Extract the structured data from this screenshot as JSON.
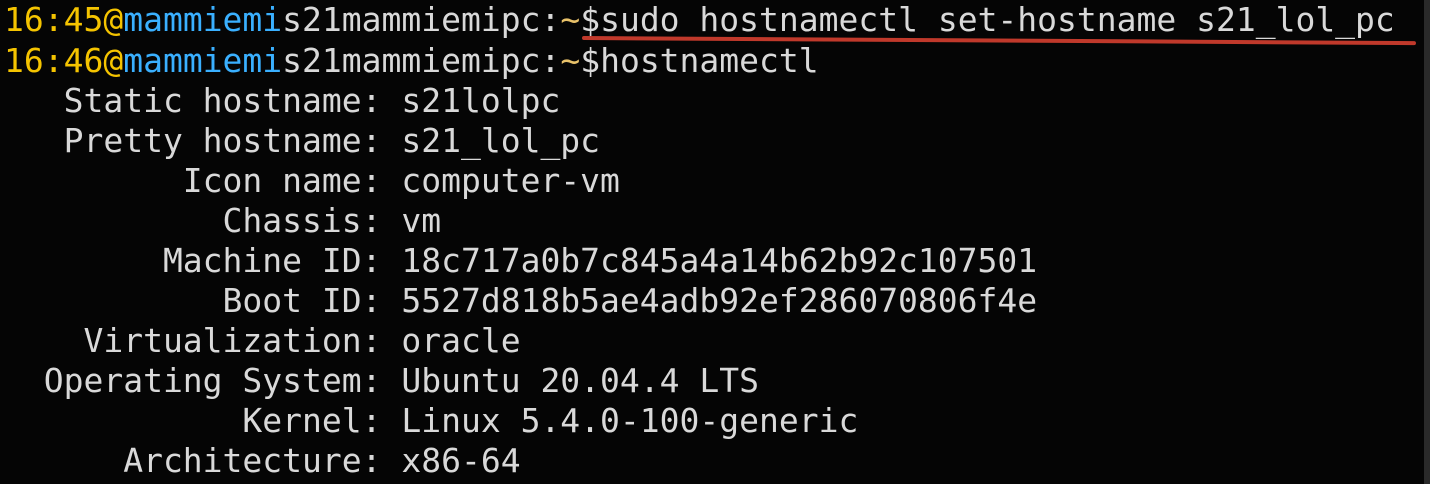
{
  "terminal": {
    "prompts": [
      {
        "time": "16:45",
        "at": "@",
        "user": "mammiemi",
        "host": "s21mammiemipc",
        "colon": ":",
        "tilde": "~",
        "dollar": "$",
        "command": "sudo hostnamectl set-hostname s21_lol_pc"
      },
      {
        "time": "16:46",
        "at": "@",
        "user": "mammiemi",
        "host": "s21mammiemipc",
        "colon": ":",
        "tilde": "~",
        "dollar": "$",
        "command": "hostnamectl"
      }
    ],
    "output": [
      {
        "key": "   Static hostname:",
        "value": " s21lolpc"
      },
      {
        "key": "   Pretty hostname:",
        "value": " s21_lol_pc"
      },
      {
        "key": "         Icon name:",
        "value": " computer-vm"
      },
      {
        "key": "           Chassis:",
        "value": " vm"
      },
      {
        "key": "        Machine ID:",
        "value": " 18c717a0b7c845a4a14b62b92c107501"
      },
      {
        "key": "           Boot ID:",
        "value": " 5527d818b5ae4adb92ef286070806f4e"
      },
      {
        "key": "    Virtualization:",
        "value": " oracle"
      },
      {
        "key": "  Operating System:",
        "value": " Ubuntu 20.04.4 LTS"
      },
      {
        "key": "            Kernel:",
        "value": " Linux 5.4.0-100-generic"
      },
      {
        "key": "      Architecture:",
        "value": " x86-64"
      }
    ],
    "colors": {
      "background": "#050505",
      "prompt_time": "#f5c400",
      "prompt_user": "#3ab0ff",
      "text": "#d9d9d9",
      "annotation": "#c0392b"
    },
    "annotation": "red-underline"
  }
}
